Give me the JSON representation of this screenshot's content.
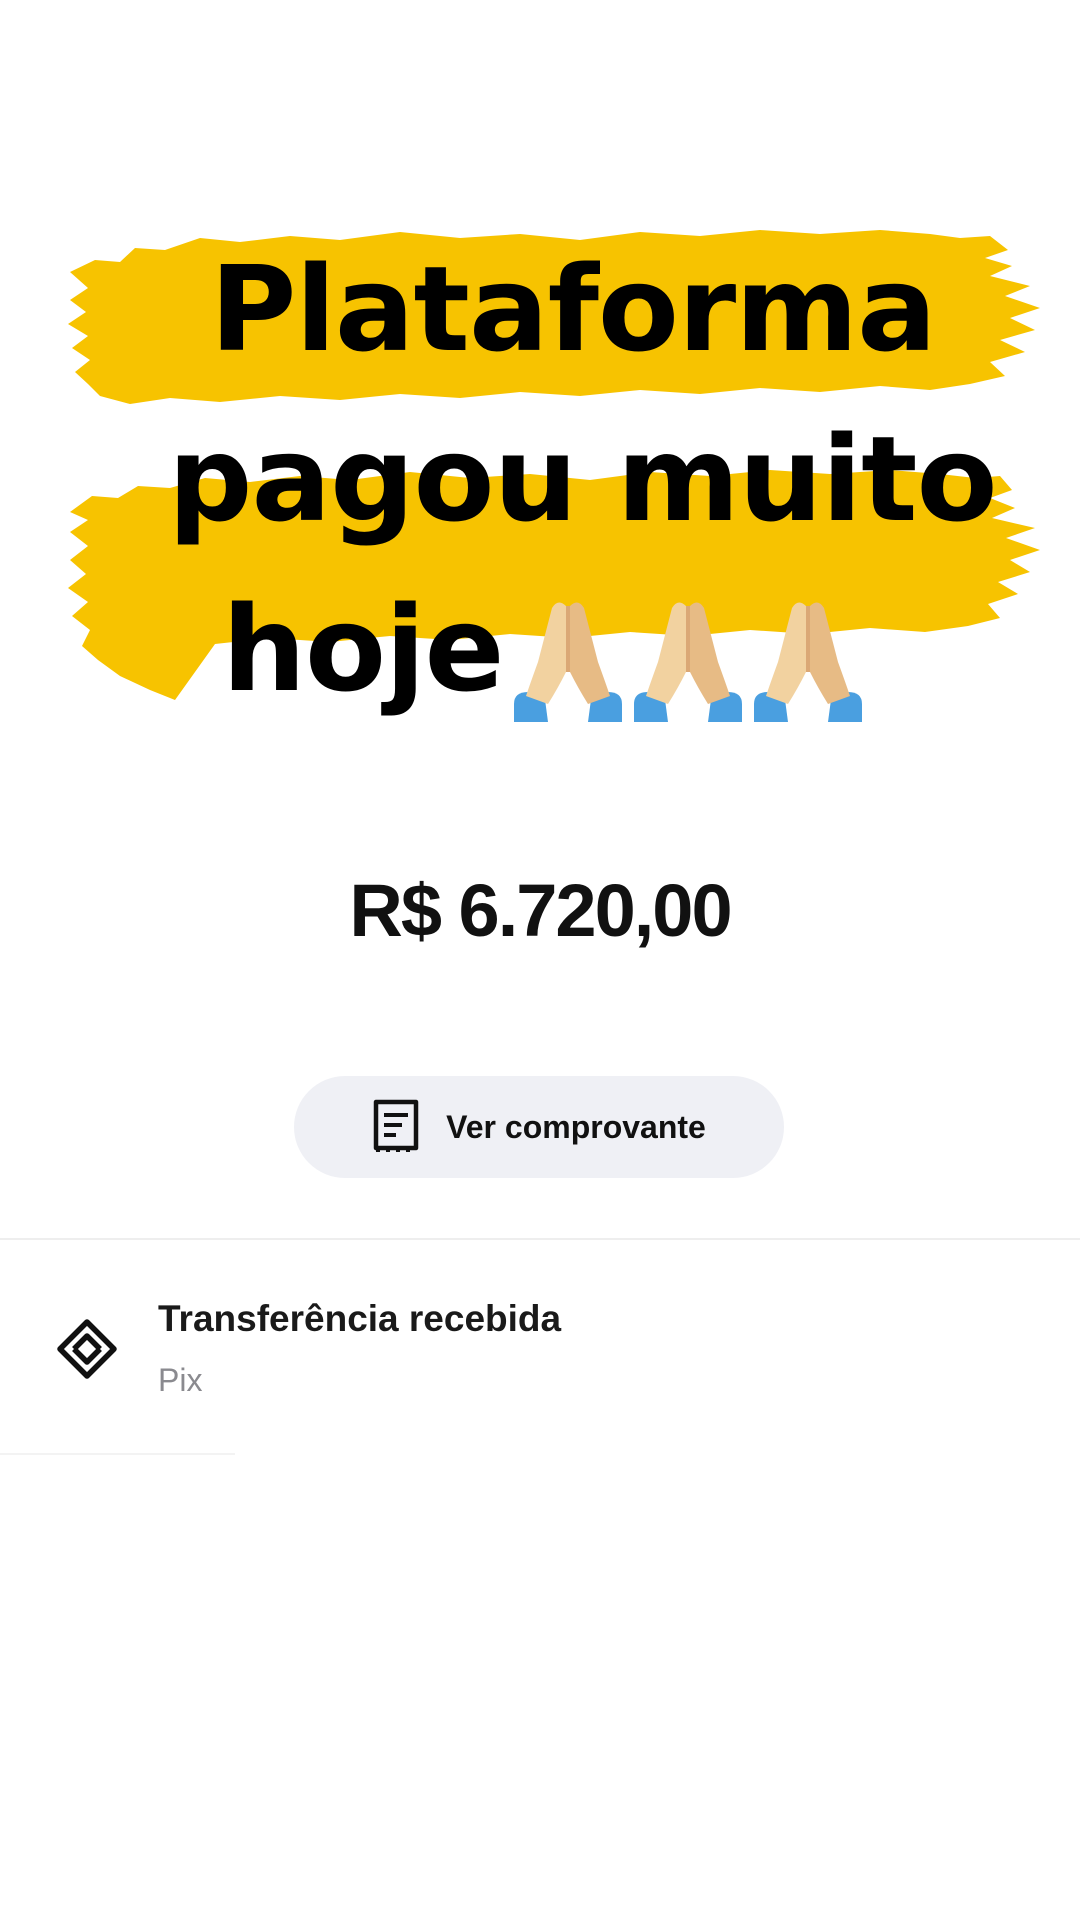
{
  "overlay": {
    "headline_line_1": "Plataforma",
    "headline_line_2": "pagou muito",
    "headline_line_3": "hoje",
    "emoji_icons": [
      "folded-hands-icon",
      "folded-hands-icon",
      "folded-hands-icon"
    ],
    "brush_color": "#f7c300"
  },
  "transaction": {
    "amount": "R$ 6.720,00",
    "receipt_button_label": "Ver comprovante",
    "receipt_icon": "receipt-icon",
    "title": "Transferência recebida",
    "subtitle": "Pix",
    "type_icon": "pix-icon"
  },
  "colors": {
    "background": "#ffffff",
    "button_background": "#eff0f5",
    "text_primary": "#111111",
    "text_secondary": "#8a8a8f"
  }
}
